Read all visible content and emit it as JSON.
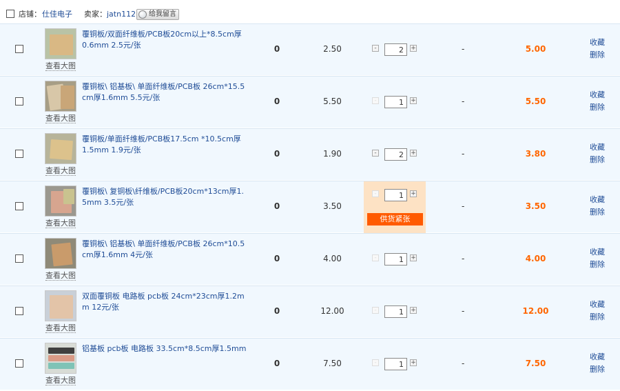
{
  "shop": {
    "store_label": "店铺：",
    "store_name": "仕佳电子",
    "seller_label": "卖家：",
    "seller_name": "jatn112",
    "message_button": "给我留言"
  },
  "view_large_label": "查看大图",
  "actions": {
    "favorite": "收藏",
    "delete": "删除"
  },
  "items": [
    {
      "title": "覆铜板/双面纤维板/PCB板20cm以上*8.5cm厚0.6mm 2.5元/张",
      "discount": "0",
      "price": "2.50",
      "quantity": "2",
      "promo": "-",
      "subtotal": "5.00"
    },
    {
      "title": "覆铜板\\ 铝基板\\ 单面纤维板/PCB板 26cm*15.5cm厚1.6mm 5.5元/张",
      "discount": "0",
      "price": "5.50",
      "quantity": "1",
      "promo": "-",
      "subtotal": "5.50"
    },
    {
      "title": "覆铜板/单面纤维板/PCB板17.5cm *10.5cm厚1.5mm 1.9元/张",
      "discount": "0",
      "price": "1.90",
      "quantity": "2",
      "promo": "-",
      "subtotal": "3.80"
    },
    {
      "title": "覆铜板\\ 复铜板\\纤维板/PCB板20cm*13cm厚1.5mm 3.5元/张",
      "discount": "0",
      "price": "3.50",
      "quantity": "1",
      "promo": "-",
      "subtotal": "3.50",
      "stock_warning": "供货紧张"
    },
    {
      "title": "覆铜板\\ 铝基板\\ 单面纤维板/PCB板 26cm*10.5cm厚1.6mm 4元/张",
      "discount": "0",
      "price": "4.00",
      "quantity": "1",
      "promo": "-",
      "subtotal": "4.00"
    },
    {
      "title": "双面覆铜板 电路板 pcb板 24cm*23cm厚1.2mm 12元/张",
      "discount": "0",
      "price": "12.00",
      "quantity": "1",
      "promo": "-",
      "subtotal": "12.00"
    },
    {
      "title": "铝基板 pcb板 电路板 33.5cm*8.5cm厚1.5mm",
      "discount": "0",
      "price": "7.50",
      "quantity": "1",
      "promo": "-",
      "subtotal": "7.50"
    }
  ],
  "colors": {
    "row_background": "#f1f8fe",
    "link_blue": "#1f4c96",
    "subtotal_orange": "#ff6600",
    "warning_badge": "#ff5a00",
    "warning_background": "#fde2c4"
  },
  "icons": {
    "message": "message-bubble-icon",
    "minus": "minus-icon",
    "plus": "plus-icon"
  }
}
